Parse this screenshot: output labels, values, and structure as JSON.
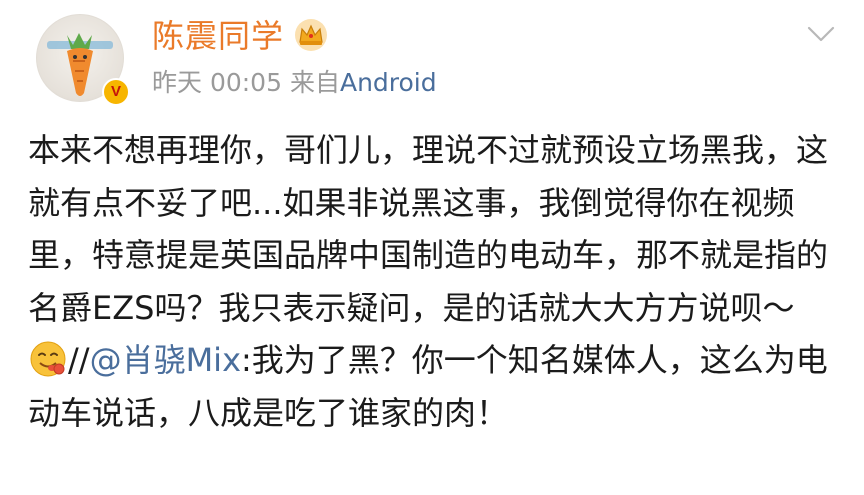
{
  "post": {
    "author": {
      "name": "陈震同学",
      "verified_badge": "V",
      "crown_icon": "crown-icon",
      "avatar_icon": "carrot-avatar"
    },
    "meta": {
      "time": "昨天 00:05",
      "source_prefix": "来自",
      "source": "Android"
    },
    "menu_icon": "chevron-down-icon",
    "content": {
      "text_main": "本来不想再理你，哥们儿，理说不过就预设立场黑我，这就有点不妥了吧...如果非说黑这事，我倒觉得你在视频里，特意提是英国品牌中国制造的电动车，那不就是指的名爵EZS吗？我只表示疑问，是的话就大大方方说呗～",
      "emoji": "yummy-face-emoji",
      "separator": "//",
      "mention": "@肖骁Mix",
      "text_reply": ":我为了黑？你一个知名媒体人，这么为电动车说话，八成是吃了谁家的肉！"
    },
    "colors": {
      "username": "#ea7a29",
      "link": "#4a6e9c",
      "meta": "#9a9a9a",
      "text": "#1b1b1b",
      "badge": "#f7b500"
    }
  }
}
